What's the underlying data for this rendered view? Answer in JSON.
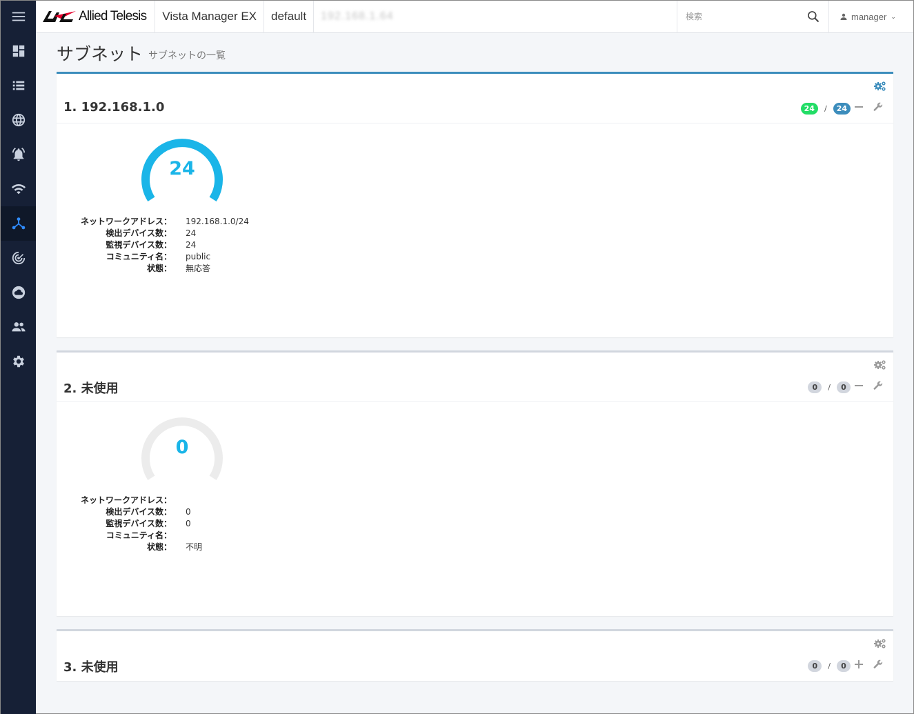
{
  "topbar": {
    "brand": "Allied Telesis",
    "product": "Vista Manager EX",
    "site": "default",
    "ip": "192.168.1.64",
    "search_placeholder": "検索",
    "user": "manager"
  },
  "page": {
    "title": "サブネット",
    "subtitle": "サブネットの一覧"
  },
  "labels": {
    "network_address": "ネットワークアドレス：",
    "detected_devices": "検出デバイス数：",
    "monitored_devices": "監視デバイス数：",
    "community": "コミュニティ名：",
    "status": "状態："
  },
  "subnets": [
    {
      "title": "1. 192.168.1.0",
      "detected_badge": "24",
      "monitored_badge": "24",
      "separator": "/",
      "gauge_value": "24",
      "gauge_fraction": 1.0,
      "network_address": "192.168.1.0/24",
      "detected_devices": "24",
      "monitored_devices": "24",
      "community": "public",
      "status": "無応答"
    },
    {
      "title": "2. 未使用",
      "detected_badge": "0",
      "monitored_badge": "0",
      "separator": "/",
      "gauge_value": "0",
      "gauge_fraction": 0.0,
      "network_address": "",
      "detected_devices": "0",
      "monitored_devices": "0",
      "community": "",
      "status": "不明"
    },
    {
      "title": "3. 未使用",
      "detected_badge": "0",
      "monitored_badge": "0",
      "separator": "/"
    }
  ],
  "colors": {
    "sidebar_bg": "#162036",
    "active_icon": "#2f8bff",
    "gauge_active": "#1ab5e8",
    "gauge_inactive": "#ececec",
    "badge_green": "#22dd66",
    "badge_blue": "#3c8dbc",
    "panel_accent": "#3c8dbc"
  },
  "sidebar": {
    "items": [
      "menu-icon",
      "dashboard-icon",
      "list-icon",
      "globe-icon",
      "alarm-icon",
      "wifi-icon",
      "subnet-icon",
      "radar-icon",
      "cloud-icon",
      "users-icon",
      "settings-icon"
    ],
    "active": "subnet-icon"
  }
}
